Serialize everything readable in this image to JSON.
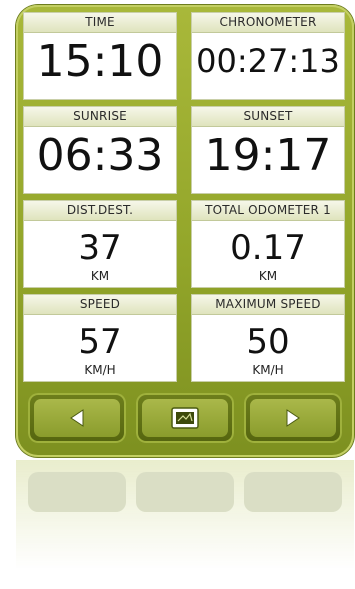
{
  "cells": {
    "time": {
      "label": "TIME",
      "value": "15:10"
    },
    "chronometer": {
      "label": "CHRONOMETER",
      "value": "00:27:13"
    },
    "sunrise": {
      "label": "SUNRISE",
      "value": "06:33"
    },
    "sunset": {
      "label": "SUNSET",
      "value": "19:17"
    },
    "dist_dest": {
      "label": "DIST.DEST.",
      "value": "37",
      "unit": "KM"
    },
    "total_odometer": {
      "label": "TOTAL ODOMETER 1",
      "value": "0.17",
      "unit": "KM"
    },
    "speed": {
      "label": "SPEED",
      "value": "57",
      "unit": "KM/H"
    },
    "max_speed": {
      "label": "MAXIMUM SPEED",
      "value": "50",
      "unit": "KM/H"
    }
  },
  "colors": {
    "frame": "#93a62a",
    "button": "#5e6f14"
  },
  "icons": {
    "prev": "left-arrow-icon",
    "center": "map-view-icon",
    "next": "right-arrow-icon"
  }
}
